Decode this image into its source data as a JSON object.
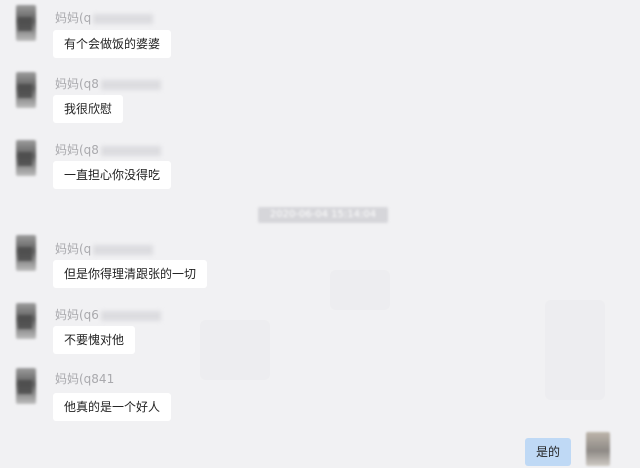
{
  "timestamp": "2020-06-04 15:14:04",
  "messages": [
    {
      "sender": "妈妈(q",
      "text": "有个会做饭的婆婆"
    },
    {
      "sender": "妈妈(q8",
      "text": "我很欣慰"
    },
    {
      "sender": "妈妈(q8",
      "text": "一直担心你没得吃"
    },
    {
      "sender": "妈妈(q",
      "text": "但是你得理清跟张的一切"
    },
    {
      "sender": "妈妈(q6",
      "text": "不要愧对他"
    },
    {
      "sender": "妈妈(q841",
      "text": "他真的是一个好人"
    }
  ],
  "self_message": {
    "text": "是的"
  }
}
